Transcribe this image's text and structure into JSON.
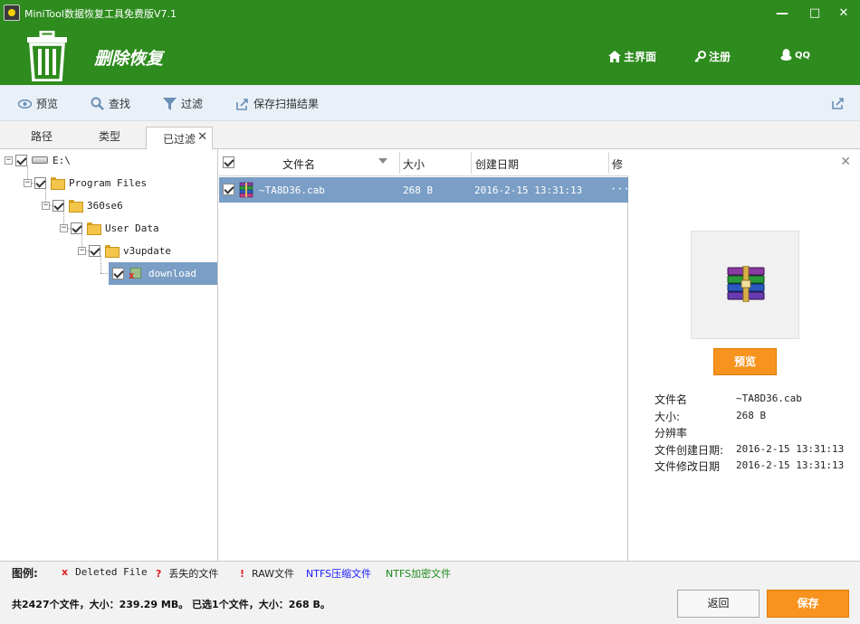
{
  "window": {
    "title": "MiniTool数据恢复工具免费版V7.1",
    "minimize": "—",
    "maximize": "□",
    "close": "✕"
  },
  "header": {
    "title": "删除恢复",
    "nav": [
      {
        "label": "主界面",
        "icon": "home-icon"
      },
      {
        "label": "注册",
        "icon": "key-icon"
      },
      {
        "label": "QQ",
        "icon": "qq-penguin-icon"
      }
    ]
  },
  "toolbar": {
    "preview": "预览",
    "find": "查找",
    "filter": "过滤",
    "save_scan": "保存扫描结果"
  },
  "tabs": {
    "path": "路径",
    "type": "类型",
    "filtered": "已过滤",
    "close": "✕"
  },
  "tree": {
    "nodes": [
      {
        "label": "E:\\",
        "checked": true
      },
      {
        "label": "Program Files",
        "checked": true
      },
      {
        "label": "360se6",
        "checked": true
      },
      {
        "label": "User Data",
        "checked": true
      },
      {
        "label": "v3update",
        "checked": true
      },
      {
        "label": "download",
        "checked": true,
        "selected": true
      }
    ]
  },
  "file_list": {
    "columns": [
      "文件名",
      "大小",
      "创建日期",
      "修"
    ],
    "rows": [
      {
        "name": "~TA8D36.cab",
        "size": "268 B",
        "created": "2016-2-15 13:31:13",
        "more": "···",
        "checked": true
      }
    ]
  },
  "preview": {
    "close": "✕",
    "button": "预览",
    "fields": [
      {
        "label": "文件名",
        "value": "~TA8D36.cab"
      },
      {
        "label": "大小:",
        "value": "268 B"
      },
      {
        "label": "分辨率",
        "value": ""
      },
      {
        "label": "文件创建日期:",
        "value": "2016-2-15 13:31:13"
      },
      {
        "label": "文件修改日期",
        "value": "2016-2-15 13:31:13"
      }
    ]
  },
  "legend": {
    "title": "图例:",
    "items": [
      {
        "mark": "x",
        "label": "Deleted File",
        "color": "#e02020"
      },
      {
        "mark": "?",
        "label": "丢失的文件",
        "color": "#e02020"
      },
      {
        "mark": "!",
        "label": "RAW文件",
        "color": "#e02020"
      },
      {
        "mark": "",
        "label": "NTFS压缩文件",
        "color": "#1a1aff"
      },
      {
        "mark": "",
        "label": "NTFS加密文件",
        "color": "#1a8a1a"
      }
    ]
  },
  "status": {
    "summary": "共2427个文件，大小：239.29 MB。 已选1个文件，大小：268 B。",
    "back": "返回",
    "save": "保存"
  },
  "colors": {
    "header_green": "#2e8b1e",
    "accent_orange": "#f7931e",
    "selection_blue": "#7a9ec5"
  }
}
